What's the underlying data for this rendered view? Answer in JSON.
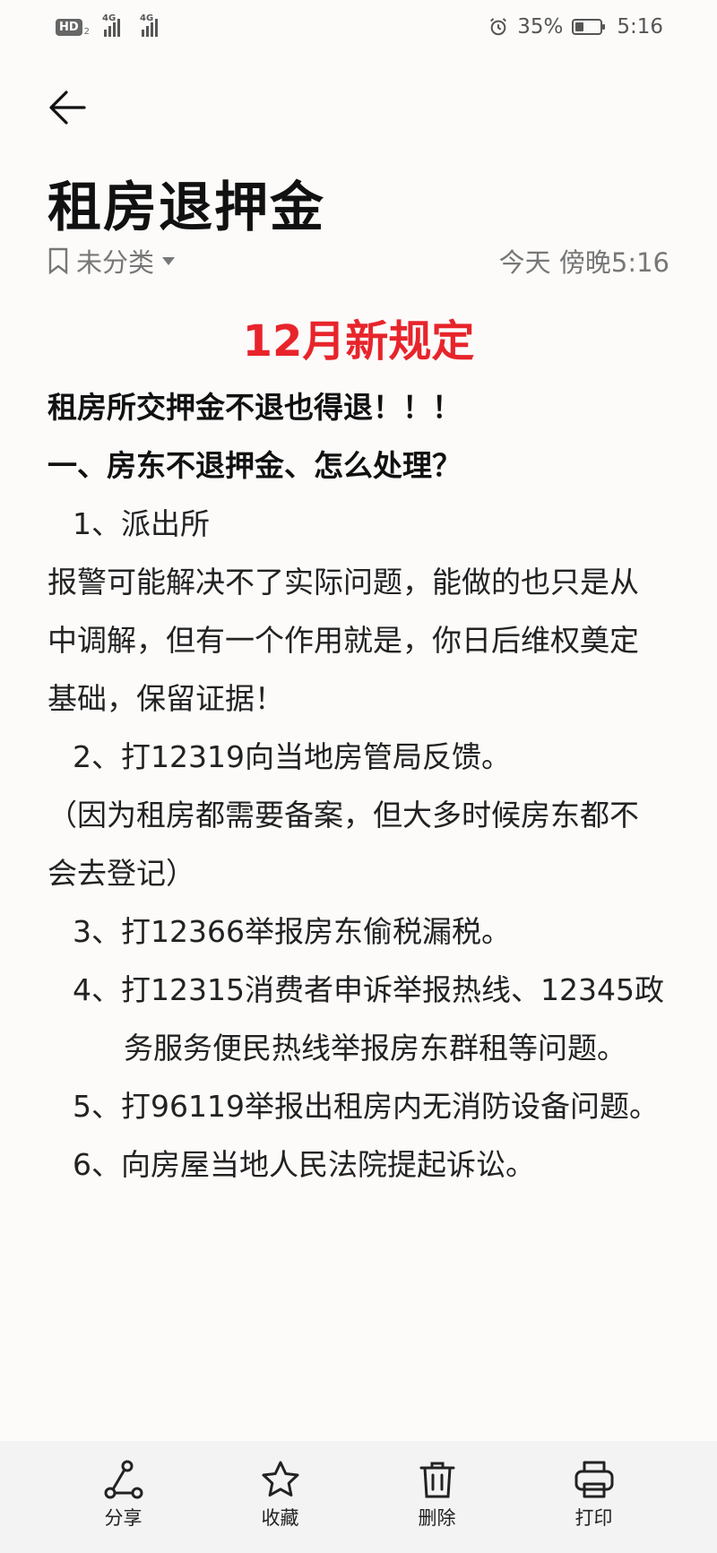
{
  "status_bar": {
    "hd_label": "HD",
    "hd_sub": "2",
    "sim1_label": "4G",
    "sim2_label": "4G",
    "battery_percent": "35%",
    "battery_level": 0.35,
    "time": "5:16",
    "icons": [
      "alarm-icon",
      "signal-icon",
      "battery-icon"
    ]
  },
  "header": {
    "back_icon": "back-arrow-icon",
    "title": "租房退押金",
    "category_icon": "bookmark-icon",
    "category_label": "未分类",
    "category_dropdown_icon": "caret-down-icon",
    "timestamp": "今天 傍晚5:16"
  },
  "note": {
    "headline": "12月新规定",
    "headline_color": "#e8242b",
    "lines": {
      "l1": "租房所交押金不退也得退！！！",
      "l2": "一、房东不退押金、怎么处理？",
      "l3": "1、派出所",
      "l4": "报警可能解决不了实际问题，能做的也只是从中调解，但有一个作用就是，你日后维权奠定基础，保留证据！",
      "l5": "2、打12319向当地房管局反馈。",
      "l6": "（因为租房都需要备案，但大多时候房东都不会去登记）",
      "l7": "3、打12366举报房东偷税漏税。",
      "l8": "4、打12315消费者申诉举报热线、12345政务服务便民热线举报房东群租等问题。",
      "l9": "5、打96119举报出租房内无消防设备问题。",
      "l10": "6、向房屋当地人民法院提起诉讼。"
    }
  },
  "bottom_bar": {
    "share": {
      "label": "分享",
      "icon": "share-icon"
    },
    "favorite": {
      "label": "收藏",
      "icon": "star-icon"
    },
    "delete": {
      "label": "删除",
      "icon": "trash-icon"
    },
    "print": {
      "label": "打印",
      "icon": "printer-icon"
    }
  }
}
